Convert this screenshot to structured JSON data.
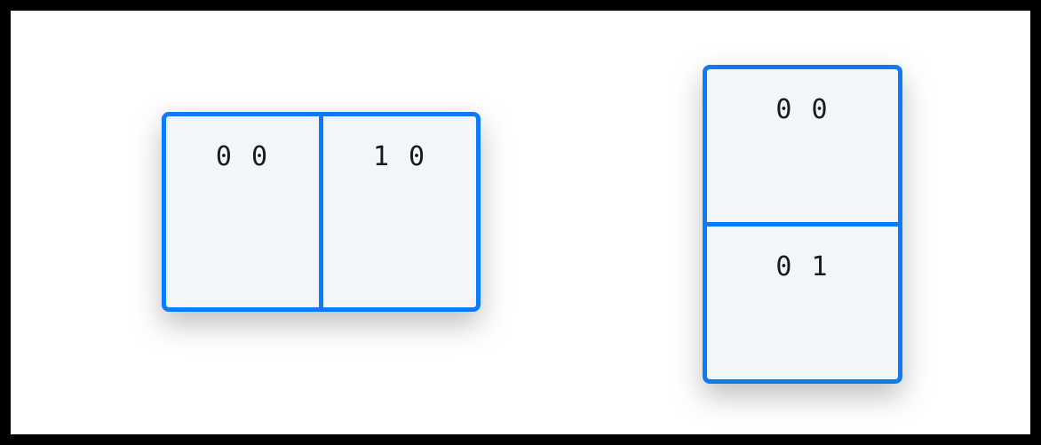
{
  "diagram": {
    "groups": [
      {
        "orientation": "row",
        "cards": [
          {
            "label": "0 0"
          },
          {
            "label": "1 0"
          }
        ]
      },
      {
        "orientation": "column",
        "cards": [
          {
            "label": "0 0"
          },
          {
            "label": "0 1"
          }
        ]
      }
    ]
  },
  "colors": {
    "border": "#0a7aff",
    "card_bg": "#f2f6fa",
    "text": "#1a1a1a"
  }
}
